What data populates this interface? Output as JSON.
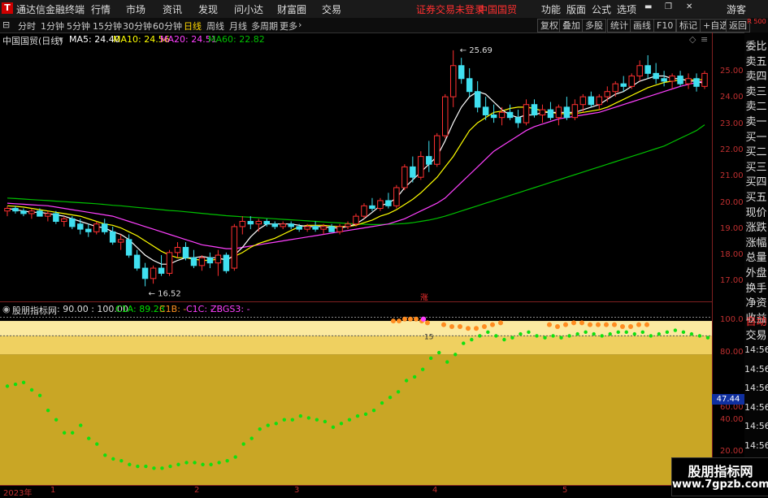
{
  "menubar": {
    "app_title": "通达信金融终端",
    "items": [
      "行情",
      "市场",
      "资讯",
      "发现",
      "问小达",
      "财富圈",
      "交易"
    ],
    "status": "证券交易未登录",
    "stock_name": "中国国贸",
    "right_items": [
      "功能",
      "版面",
      "公式",
      "选项"
    ],
    "user": "游客"
  },
  "toolbar": {
    "periods": [
      "分时",
      "1分钟",
      "5分钟",
      "15分钟",
      "30分钟",
      "60分钟",
      "日线",
      "周线",
      "月线",
      "多周期",
      "更多"
    ],
    "active": "日线",
    "right_buttons": [
      "复权",
      "叠加",
      "多股",
      "统计",
      "画线",
      "F10",
      "标记",
      "+自选",
      "返回"
    ]
  },
  "main_legend": {
    "title": "中国国贸(日线)",
    "ma5": "MA5: 24.40",
    "ma10": "MA10: 24.56",
    "ma20": "MA20: 24.51",
    "ma60": "MA60: 22.82",
    "colors": {
      "ma5": "#ffffff",
      "ma10": "#ffff00",
      "ma20": "#ff40ff",
      "ma60": "#00c000",
      "up": "#ff3030",
      "down": "#40e0f0"
    }
  },
  "annotations": {
    "high": "25.69",
    "low": "16.52",
    "zhang": "涨",
    "sub_marker": "15"
  },
  "price_axis": [
    "25.00",
    "24.00",
    "23.00",
    "22.00",
    "21.00",
    "20.00",
    "19.00",
    "18.00",
    "17.00"
  ],
  "sub_legend": {
    "title": "股朋指标网",
    "values": ": 90.00 : 100.00",
    "c1a": "C1A: 89.23",
    "c1b": "C1B: -",
    "c1c": "C1C: -",
    "zbgs3": "ZBGS3: -"
  },
  "sub_axis": [
    "100.0",
    "80.00",
    "60.00",
    "40.00",
    "20.00"
  ],
  "sub_current": "47.44",
  "dates": [
    "2023年",
    "1",
    "2",
    "3",
    "4",
    "5"
  ],
  "right_panel": [
    "委比",
    "卖五",
    "卖四",
    "卖三",
    "卖二",
    "卖一",
    "买一",
    "买二",
    "买三",
    "买四",
    "买五",
    "现价",
    "涨跌",
    "涨幅",
    "总量",
    "外盘",
    "换手",
    "净资",
    "收益",
    "自动",
    "交易"
  ],
  "right_top": "R 500",
  "times": [
    "14:56",
    "14:56",
    "14:56",
    "14:56",
    "14:56",
    "14:56",
    "14:56"
  ],
  "watermark": {
    "line1": "股朋指标网",
    "line2": "www.7gpzb.com"
  },
  "chart_data": {
    "type": "candlestick",
    "title": "中国国贸(日线)",
    "ylim": [
      16.3,
      26.0
    ],
    "candles_ohlc": [
      [
        19.5,
        19.7,
        19.3,
        19.6
      ],
      [
        19.6,
        19.7,
        19.4,
        19.5
      ],
      [
        19.5,
        19.6,
        19.3,
        19.4
      ],
      [
        19.4,
        19.6,
        19.2,
        19.5
      ],
      [
        19.5,
        19.6,
        19.3,
        19.3
      ],
      [
        19.3,
        19.5,
        19.1,
        19.4
      ],
      [
        19.4,
        19.5,
        19.0,
        19.1
      ],
      [
        19.1,
        19.3,
        18.9,
        19.2
      ],
      [
        19.2,
        19.3,
        18.8,
        18.9
      ],
      [
        19.0,
        19.2,
        18.6,
        18.8
      ],
      [
        18.8,
        19.0,
        18.5,
        18.7
      ],
      [
        18.7,
        19.1,
        18.6,
        19.0
      ],
      [
        19.0,
        19.2,
        18.6,
        18.7
      ],
      [
        18.7,
        18.9,
        18.2,
        18.3
      ],
      [
        18.3,
        18.6,
        18.0,
        18.4
      ],
      [
        18.4,
        18.6,
        17.7,
        17.8
      ],
      [
        17.8,
        18.0,
        17.2,
        17.3
      ],
      [
        17.3,
        17.5,
        16.6,
        16.9
      ],
      [
        16.9,
        17.4,
        16.7,
        17.3
      ],
      [
        17.3,
        17.8,
        17.0,
        17.1
      ],
      [
        17.1,
        18.0,
        17.0,
        17.9
      ],
      [
        17.9,
        18.3,
        17.7,
        18.1
      ],
      [
        18.1,
        18.3,
        17.6,
        17.7
      ],
      [
        17.7,
        18.0,
        17.3,
        17.4
      ],
      [
        17.4,
        17.8,
        17.2,
        17.7
      ],
      [
        17.7,
        17.9,
        17.3,
        17.5
      ],
      [
        17.5,
        18.0,
        17.0,
        17.8
      ],
      [
        17.8,
        17.9,
        17.1,
        17.2
      ],
      [
        17.3,
        19.0,
        17.2,
        18.9
      ],
      [
        18.9,
        19.3,
        18.6,
        19.1
      ],
      [
        19.1,
        19.3,
        18.8,
        19.0
      ],
      [
        19.0,
        19.2,
        18.7,
        19.1
      ],
      [
        19.1,
        19.2,
        18.9,
        19.0
      ],
      [
        19.0,
        19.1,
        18.8,
        18.9
      ],
      [
        18.9,
        19.1,
        18.8,
        19.0
      ],
      [
        19.0,
        19.1,
        18.8,
        18.9
      ],
      [
        18.9,
        19.0,
        18.7,
        18.8
      ],
      [
        18.8,
        19.0,
        18.7,
        18.9
      ],
      [
        18.9,
        19.1,
        18.7,
        18.8
      ],
      [
        18.8,
        19.0,
        18.6,
        18.9
      ],
      [
        18.9,
        19.0,
        18.7,
        18.7
      ],
      [
        18.7,
        19.0,
        18.6,
        18.9
      ],
      [
        18.9,
        19.1,
        18.8,
        19.0
      ],
      [
        19.0,
        19.4,
        18.9,
        19.3
      ],
      [
        19.3,
        19.8,
        19.2,
        19.7
      ],
      [
        19.7,
        20.0,
        19.5,
        19.6
      ],
      [
        19.6,
        20.0,
        19.5,
        19.9
      ],
      [
        19.9,
        20.2,
        19.6,
        19.7
      ],
      [
        19.7,
        20.5,
        19.6,
        20.4
      ],
      [
        20.4,
        21.3,
        20.3,
        21.2
      ],
      [
        21.2,
        21.6,
        20.6,
        20.8
      ],
      [
        20.8,
        21.8,
        20.7,
        21.6
      ],
      [
        21.6,
        22.2,
        21.0,
        21.3
      ],
      [
        21.3,
        22.5,
        21.2,
        22.4
      ],
      [
        22.4,
        24.0,
        22.3,
        23.9
      ],
      [
        23.9,
        25.69,
        23.5,
        25.1
      ],
      [
        25.1,
        25.4,
        24.4,
        24.6
      ],
      [
        24.6,
        25.0,
        23.9,
        24.1
      ],
      [
        24.1,
        24.5,
        23.3,
        23.5
      ],
      [
        23.5,
        23.9,
        23.0,
        23.2
      ],
      [
        23.2,
        23.6,
        22.9,
        23.1
      ],
      [
        23.1,
        23.5,
        22.8,
        23.3
      ],
      [
        23.3,
        23.6,
        23.0,
        23.1
      ],
      [
        23.1,
        23.4,
        22.7,
        22.9
      ],
      [
        22.9,
        23.8,
        22.8,
        23.6
      ],
      [
        23.6,
        23.8,
        23.1,
        23.2
      ],
      [
        23.2,
        23.6,
        22.9,
        23.4
      ],
      [
        23.4,
        23.7,
        23.0,
        23.1
      ],
      [
        23.1,
        23.6,
        22.8,
        23.5
      ],
      [
        23.5,
        23.9,
        23.0,
        23.1
      ],
      [
        23.1,
        23.8,
        23.0,
        23.6
      ],
      [
        23.6,
        24.0,
        23.3,
        23.9
      ],
      [
        23.9,
        24.1,
        23.5,
        23.6
      ],
      [
        23.6,
        24.0,
        23.4,
        23.9
      ],
      [
        23.9,
        24.3,
        23.7,
        24.1
      ],
      [
        24.1,
        24.5,
        23.9,
        24.4
      ],
      [
        24.4,
        24.7,
        24.1,
        24.3
      ],
      [
        24.3,
        24.8,
        24.2,
        24.7
      ],
      [
        24.7,
        25.3,
        24.5,
        25.1
      ],
      [
        25.1,
        25.5,
        24.6,
        24.8
      ],
      [
        24.8,
        25.2,
        24.4,
        24.6
      ],
      [
        24.6,
        24.9,
        24.3,
        24.5
      ],
      [
        24.5,
        24.8,
        24.2,
        24.7
      ],
      [
        24.7,
        24.9,
        24.3,
        24.4
      ],
      [
        24.4,
        24.8,
        24.2,
        24.6
      ],
      [
        24.6,
        24.8,
        24.1,
        24.3
      ],
      [
        24.3,
        24.9,
        24.2,
        24.8
      ]
    ],
    "ma5": [
      19.6,
      19.55,
      19.5,
      19.45,
      19.45,
      19.4,
      19.35,
      19.3,
      19.2,
      19.1,
      19.0,
      18.9,
      18.85,
      18.7,
      18.6,
      18.4,
      18.1,
      17.8,
      17.6,
      17.45,
      17.45,
      17.6,
      17.7,
      17.7,
      17.75,
      17.7,
      17.7,
      17.6,
      17.8,
      18.1,
      18.5,
      18.8,
      19.0,
      19.0,
      19.0,
      19.0,
      18.95,
      18.9,
      18.9,
      18.9,
      18.85,
      18.85,
      18.9,
      19.0,
      19.2,
      19.45,
      19.7,
      19.8,
      20.0,
      20.4,
      20.7,
      21.0,
      21.3,
      21.6,
      22.2,
      22.9,
      23.5,
      23.9,
      24.1,
      24.0,
      23.7,
      23.4,
      23.2,
      23.1,
      23.2,
      23.2,
      23.3,
      23.3,
      23.3,
      23.3,
      23.3,
      23.4,
      23.5,
      23.6,
      23.8,
      24.0,
      24.1,
      24.3,
      24.5,
      24.6,
      24.7,
      24.7,
      24.6,
      24.6,
      24.5,
      24.5,
      24.4
    ],
    "ma10": [
      19.7,
      19.68,
      19.65,
      19.6,
      19.55,
      19.5,
      19.45,
      19.4,
      19.35,
      19.3,
      19.2,
      19.1,
      19.0,
      18.95,
      18.85,
      18.7,
      18.55,
      18.35,
      18.15,
      17.95,
      17.8,
      17.7,
      17.7,
      17.65,
      17.6,
      17.6,
      17.65,
      17.65,
      17.75,
      17.9,
      18.1,
      18.25,
      18.35,
      18.45,
      18.6,
      18.75,
      18.9,
      18.95,
      18.95,
      18.95,
      18.92,
      18.9,
      18.9,
      18.95,
      19.05,
      19.15,
      19.3,
      19.4,
      19.55,
      19.75,
      19.95,
      20.2,
      20.5,
      20.8,
      21.2,
      21.6,
      22.1,
      22.6,
      22.9,
      23.1,
      23.3,
      23.35,
      23.45,
      23.5,
      23.5,
      23.45,
      23.35,
      23.3,
      23.25,
      23.25,
      23.25,
      23.3,
      23.35,
      23.4,
      23.5,
      23.65,
      23.8,
      23.95,
      24.1,
      24.25,
      24.35,
      24.45,
      24.5,
      24.55,
      24.55,
      24.55,
      24.56
    ],
    "ma20": [
      19.8,
      19.78,
      19.76,
      19.74,
      19.72,
      19.7,
      19.65,
      19.6,
      19.55,
      19.5,
      19.45,
      19.4,
      19.35,
      19.3,
      19.2,
      19.1,
      19.0,
      18.9,
      18.8,
      18.7,
      18.6,
      18.5,
      18.4,
      18.3,
      18.2,
      18.15,
      18.1,
      18.05,
      18.05,
      18.1,
      18.15,
      18.2,
      18.25,
      18.3,
      18.35,
      18.4,
      18.45,
      18.5,
      18.55,
      18.6,
      18.65,
      18.7,
      18.75,
      18.8,
      18.85,
      18.9,
      18.95,
      19.0,
      19.1,
      19.2,
      19.35,
      19.5,
      19.65,
      19.8,
      20.0,
      20.3,
      20.6,
      20.9,
      21.2,
      21.5,
      21.8,
      22.0,
      22.2,
      22.4,
      22.6,
      22.75,
      22.85,
      22.95,
      23.05,
      23.1,
      23.15,
      23.2,
      23.25,
      23.3,
      23.4,
      23.5,
      23.6,
      23.7,
      23.8,
      23.9,
      24.0,
      24.1,
      24.2,
      24.3,
      24.38,
      24.45,
      24.51
    ],
    "ma60": [
      20.0,
      19.98,
      19.96,
      19.94,
      19.92,
      19.9,
      19.88,
      19.86,
      19.84,
      19.82,
      19.8,
      19.78,
      19.75,
      19.72,
      19.7,
      19.67,
      19.64,
      19.61,
      19.58,
      19.55,
      19.52,
      19.5,
      19.47,
      19.44,
      19.41,
      19.38,
      19.35,
      19.32,
      19.3,
      19.28,
      19.26,
      19.24,
      19.22,
      19.2,
      19.18,
      19.16,
      19.14,
      19.12,
      19.1,
      19.08,
      19.06,
      19.04,
      19.02,
      19.0,
      18.99,
      18.98,
      18.98,
      18.99,
      19.0,
      19.02,
      19.05,
      19.1,
      19.15,
      19.22,
      19.3,
      19.4,
      19.5,
      19.6,
      19.7,
      19.8,
      19.9,
      20.0,
      20.1,
      20.2,
      20.3,
      20.4,
      20.5,
      20.6,
      20.7,
      20.8,
      20.9,
      21.0,
      21.1,
      21.2,
      21.3,
      21.4,
      21.5,
      21.6,
      21.7,
      21.8,
      21.9,
      22.0,
      22.15,
      22.3,
      22.45,
      22.6,
      22.82
    ],
    "sub_indicator": {
      "ylim": [
        10,
        105
      ],
      "green_dots": [
        63,
        64,
        65,
        61,
        58,
        50,
        45,
        38,
        38,
        42,
        35,
        32,
        26,
        24,
        23,
        21,
        20,
        20,
        19,
        19,
        20,
        21,
        22,
        22,
        21,
        21,
        22,
        23,
        25,
        32,
        35,
        40,
        42,
        43,
        45,
        45,
        47,
        46,
        45,
        44,
        41,
        43,
        45,
        47,
        48,
        50,
        54,
        57,
        60,
        66,
        68,
        72,
        78,
        81,
        76,
        80,
        86,
        88,
        90,
        92,
        90,
        88,
        89,
        91,
        92,
        90,
        89,
        90,
        89,
        90,
        91,
        92,
        91,
        90,
        91,
        92,
        92,
        91,
        92,
        90,
        91,
        92,
        93,
        92,
        91,
        90,
        89
      ],
      "orange_dots": [
        98,
        98,
        99,
        99,
        99,
        98,
        97,
        96,
        95,
        95,
        94,
        94,
        95,
        96,
        97,
        96,
        95,
        96,
        97,
        97,
        96,
        96,
        96,
        96,
        95,
        95,
        96,
        96
      ],
      "band_upper": 95,
      "band_mid": 90,
      "band_lower": 80
    }
  }
}
